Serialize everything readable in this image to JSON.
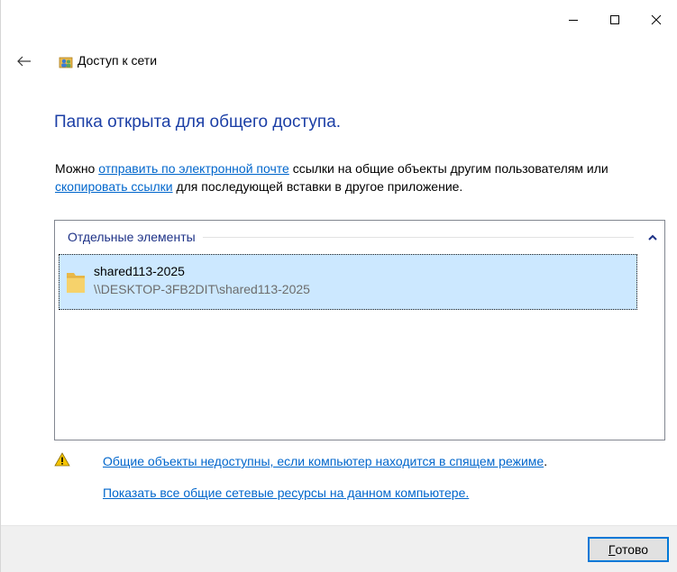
{
  "window": {
    "title": "Доступ к сети"
  },
  "heading": "Папка открыта для общего доступа.",
  "description": {
    "part1": "Можно ",
    "link_email": "отправить по электронной почте",
    "part2": " ссылки на общие объекты другим пользователям или ",
    "link_copy": "скопировать ссылки",
    "part3": " для последующей вставки в другое приложение."
  },
  "list": {
    "group_label": "Отдельные элементы",
    "items": [
      {
        "name": "shared113-2025",
        "path": "\\\\DESKTOP-3FB2DIT\\shared113-2025"
      }
    ]
  },
  "notes": {
    "sleep_link": "Общие объекты недоступны, если компьютер находится в спящем режиме",
    "sleep_period": ".",
    "show_all_link": "Показать все общие сетевые ресурсы на данном компьютере."
  },
  "buttons": {
    "done_accel": "Г",
    "done_rest": "отово"
  },
  "colors": {
    "heading": "#1c3fa6",
    "link": "#0066cc",
    "selection": "#cce8ff",
    "accent": "#0078d7"
  },
  "icons": {
    "back": "arrow-left-icon",
    "title": "network-sharing-icon",
    "folder": "folder-icon",
    "warning": "warning-icon"
  }
}
